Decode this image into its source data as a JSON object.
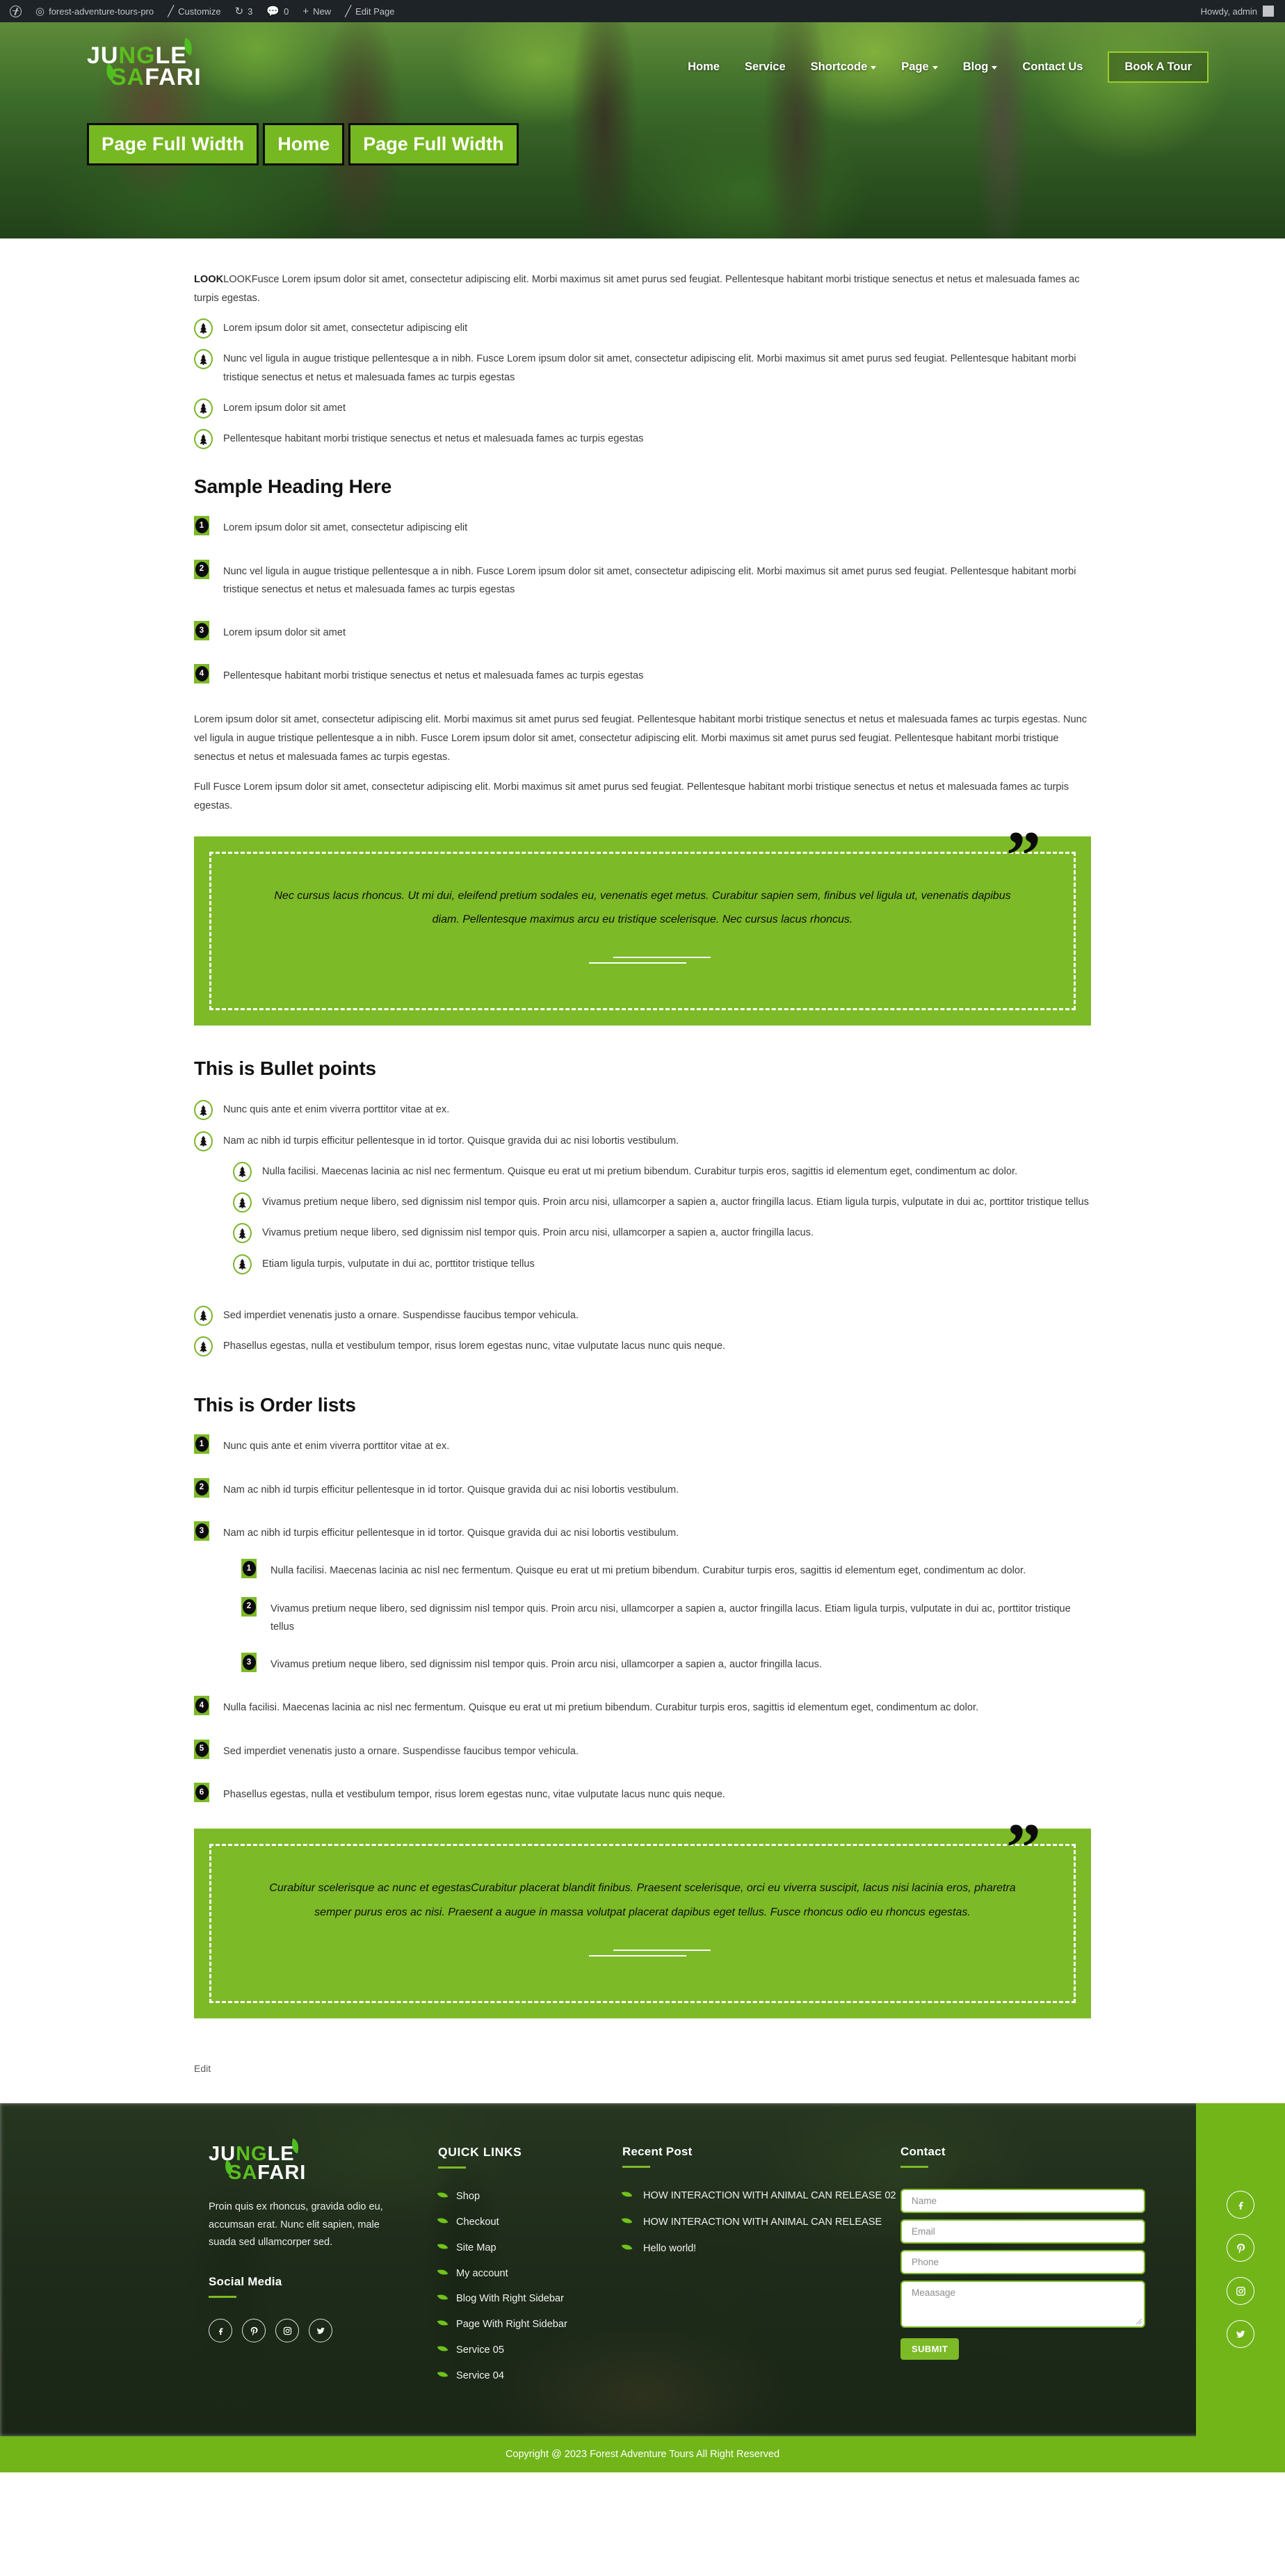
{
  "adminbar": {
    "logo_icon": "wordpress-logo-icon",
    "site_icon": "dashboard-icon",
    "site_name": "forest-adventure-tours-pro",
    "customize_icon": "pencil-icon",
    "customize": "Customize",
    "updates_icon": "updates-icon",
    "updates_count": "3",
    "comments_icon": "comment-bubble-icon",
    "comments_count": "0",
    "new_icon": "plus-icon",
    "new": "New",
    "edit_icon": "pencil-icon",
    "edit_page": "Edit Page",
    "howdy": "Howdy, admin"
  },
  "header": {
    "logo": {
      "line1_a": "JU",
      "line1_b": "NG",
      "line1_c": "LE",
      "line2_a": "SA",
      "line2_b": "FARI"
    },
    "nav": [
      {
        "label": "Home",
        "has_caret": false
      },
      {
        "label": "Service",
        "has_caret": false
      },
      {
        "label": "Shortcode",
        "has_caret": true
      },
      {
        "label": "Page",
        "has_caret": true
      },
      {
        "label": "Blog",
        "has_caret": true
      },
      {
        "label": "Contact Us",
        "has_caret": false
      }
    ],
    "cta": "Book A Tour"
  },
  "page_title": {
    "title": "Page Full Width",
    "breadcrumb": [
      "Home",
      "Page Full Width"
    ]
  },
  "content": {
    "intro_bold": "LOOK",
    "intro_text": "LOOKFusce Lorem ipsum dolor sit amet, consectetur adipiscing elit. Morbi maximus sit amet purus sed feugiat. Pellentesque habitant morbi tristique senectus et netus et malesuada fames ac turpis egestas.",
    "intro_list": [
      "Lorem ipsum dolor sit amet, consectetur adipiscing elit",
      "Nunc vel ligula in augue tristique pellentesque a in nibh. Fusce Lorem ipsum dolor sit amet, consectetur adipiscing elit. Morbi maximus sit amet purus sed feugiat. Pellentesque habitant morbi tristique senectus et netus et malesuada fames ac turpis egestas",
      "Lorem ipsum dolor sit amet",
      "Pellentesque habitant morbi tristique senectus et netus et malesuada fames ac turpis egestas"
    ],
    "sample_heading": "Sample Heading Here",
    "sample_list": [
      "Lorem ipsum dolor sit amet, consectetur adipiscing elit",
      "Nunc vel ligula in augue tristique pellentesque a in nibh. Fusce Lorem ipsum dolor sit amet, consectetur adipiscing elit. Morbi maximus sit amet purus sed feugiat. Pellentesque habitant morbi tristique senectus et netus et malesuada fames ac turpis egestas",
      "Lorem ipsum dolor sit amet",
      "Pellentesque habitant morbi tristique senectus et netus et malesuada fames ac turpis egestas"
    ],
    "para_1": "Lorem ipsum dolor sit amet, consectetur adipiscing elit. Morbi maximus sit amet purus sed feugiat. Pellentesque habitant morbi tristique senectus et netus et malesuada fames ac turpis egestas. Nunc vel ligula in augue tristique pellentesque a in nibh. Fusce Lorem ipsum dolor sit amet, consectetur adipiscing elit. Morbi maximus sit amet purus sed feugiat. Pellentesque habitant morbi tristique senectus et netus et malesuada fames ac turpis egestas.",
    "para_2": "Full Fusce Lorem ipsum dolor sit amet, consectetur adipiscing elit. Morbi maximus sit amet purus sed feugiat. Pellentesque habitant morbi tristique senectus et netus et malesuada fames ac turpis egestas.",
    "quote_1": "Nec cursus lacus rhoncus. Ut mi dui, eleifend pretium sodales eu, venenatis eget metus. Curabitur sapien sem, finibus vel ligula ut, venenatis dapibus diam. Pellentesque maximus arcu eu tristique scelerisque. Nec cursus lacus rhoncus.",
    "bullet_heading": "This is Bullet points",
    "bullet_list": [
      "Nunc quis ante et enim viverra porttitor vitae at ex.",
      "Nam ac nibh id turpis efficitur pellentesque in id tortor. Quisque gravida dui ac nisi lobortis vestibulum."
    ],
    "bullet_sublist": [
      "Nulla facilisi. Maecenas lacinia ac nisl nec fermentum. Quisque eu erat ut mi pretium bibendum. Curabitur turpis eros, sagittis id elementum eget, condimentum ac dolor.",
      "Vivamus pretium neque libero, sed dignissim nisl tempor quis. Proin arcu nisi, ullamcorper a sapien a, auctor fringilla lacus. Etiam ligula turpis, vulputate in dui ac, porttitor tristique tellus",
      "Vivamus pretium neque libero, sed dignissim nisl tempor quis. Proin arcu nisi, ullamcorper a sapien a, auctor fringilla lacus.",
      "Etiam ligula turpis, vulputate in dui ac, porttitor tristique tellus"
    ],
    "bullet_list_tail": [
      "Sed imperdiet venenatis justo a ornare. Suspendisse faucibus tempor vehicula.",
      "Phasellus egestas, nulla et vestibulum tempor, risus lorem egestas nunc, vitae vulputate lacus nunc quis neque."
    ],
    "order_heading": "This is Order lists",
    "order_list": [
      "Nunc quis ante et enim viverra porttitor vitae at ex.",
      "Nam ac nibh id turpis efficitur pellentesque in id tortor. Quisque gravida dui ac nisi lobortis vestibulum.",
      "Nam ac nibh id turpis efficitur pellentesque in id tortor. Quisque gravida dui ac nisi lobortis vestibulum."
    ],
    "order_sublist": [
      "Nulla facilisi. Maecenas lacinia ac nisl nec fermentum. Quisque eu erat ut mi pretium bibendum. Curabitur turpis eros, sagittis id elementum eget, condimentum ac dolor.",
      "Vivamus pretium neque libero, sed dignissim nisl tempor quis. Proin arcu nisi, ullamcorper a sapien a, auctor fringilla lacus. Etiam ligula turpis, vulputate in dui ac, porttitor tristique tellus",
      "Vivamus pretium neque libero, sed dignissim nisl tempor quis. Proin arcu nisi, ullamcorper a sapien a, auctor fringilla lacus."
    ],
    "order_list_tail": [
      "Nulla facilisi. Maecenas lacinia ac nisl nec fermentum. Quisque eu erat ut mi pretium bibendum. Curabitur turpis eros, sagittis id elementum eget, condimentum ac dolor.",
      "Sed imperdiet venenatis justo a ornare. Suspendisse faucibus tempor vehicula.",
      "Phasellus egestas, nulla et vestibulum tempor, risus lorem egestas nunc, vitae vulputate lacus nunc quis neque."
    ],
    "quote_2": "Curabitur scelerisque ac nunc et egestasCurabitur placerat blandit finibus. Praesent scelerisque, orci eu viverra suscipit, lacus nisi lacinia eros, pharetra semper purus eros ac nisi. Praesent a augue in massa volutpat placerat dapibus eget tellus. Fusce rhoncus odio eu rhoncus egestas.",
    "edit": "Edit",
    "quote_glyph": "”"
  },
  "footer": {
    "logo": {
      "line1_a": "JU",
      "line1_b": "NG",
      "line1_c": "LE",
      "line2_a": "SA",
      "line2_b": "FARI"
    },
    "description": "Proin quis ex rhoncus, gravida odio eu, accumsan erat. Nunc elit sapien, male suada sed ullamcorper sed.",
    "social_heading": "Social Media",
    "social": [
      "facebook-icon",
      "pinterest-icon",
      "instagram-icon",
      "twitter-icon"
    ],
    "quick_links_heading": "QUICK LINKS",
    "quick_links": [
      "Shop",
      "Checkout",
      "Site Map",
      "My account",
      "Blog With Right Sidebar",
      "Page With Right Sidebar",
      "Service 05",
      "Service 04"
    ],
    "recent_post_heading": "Recent Post",
    "recent_posts": [
      "HOW INTERACTION WITH ANIMAL CAN RELEASE 02",
      "HOW INTERACTION WITH ANIMAL CAN RELEASE",
      "Hello world!"
    ],
    "contact_heading": "Contact",
    "form": {
      "name_placeholder": "Name",
      "email_placeholder": "Email",
      "phone_placeholder": "Phone",
      "message_placeholder": "Meaasage",
      "submit": "SUBMIT"
    },
    "side_social": [
      "facebook-icon",
      "pinterest-icon",
      "instagram-icon",
      "twitter-icon"
    ],
    "copyright": "Copyright @ 2023 Forest Adventure Tours All Right Reserved"
  },
  "colors": {
    "brand_green": "#7cba27",
    "bright_green": "#5bbf1f",
    "admin_dark": "#1d2327",
    "footer_green": "#72b519"
  }
}
